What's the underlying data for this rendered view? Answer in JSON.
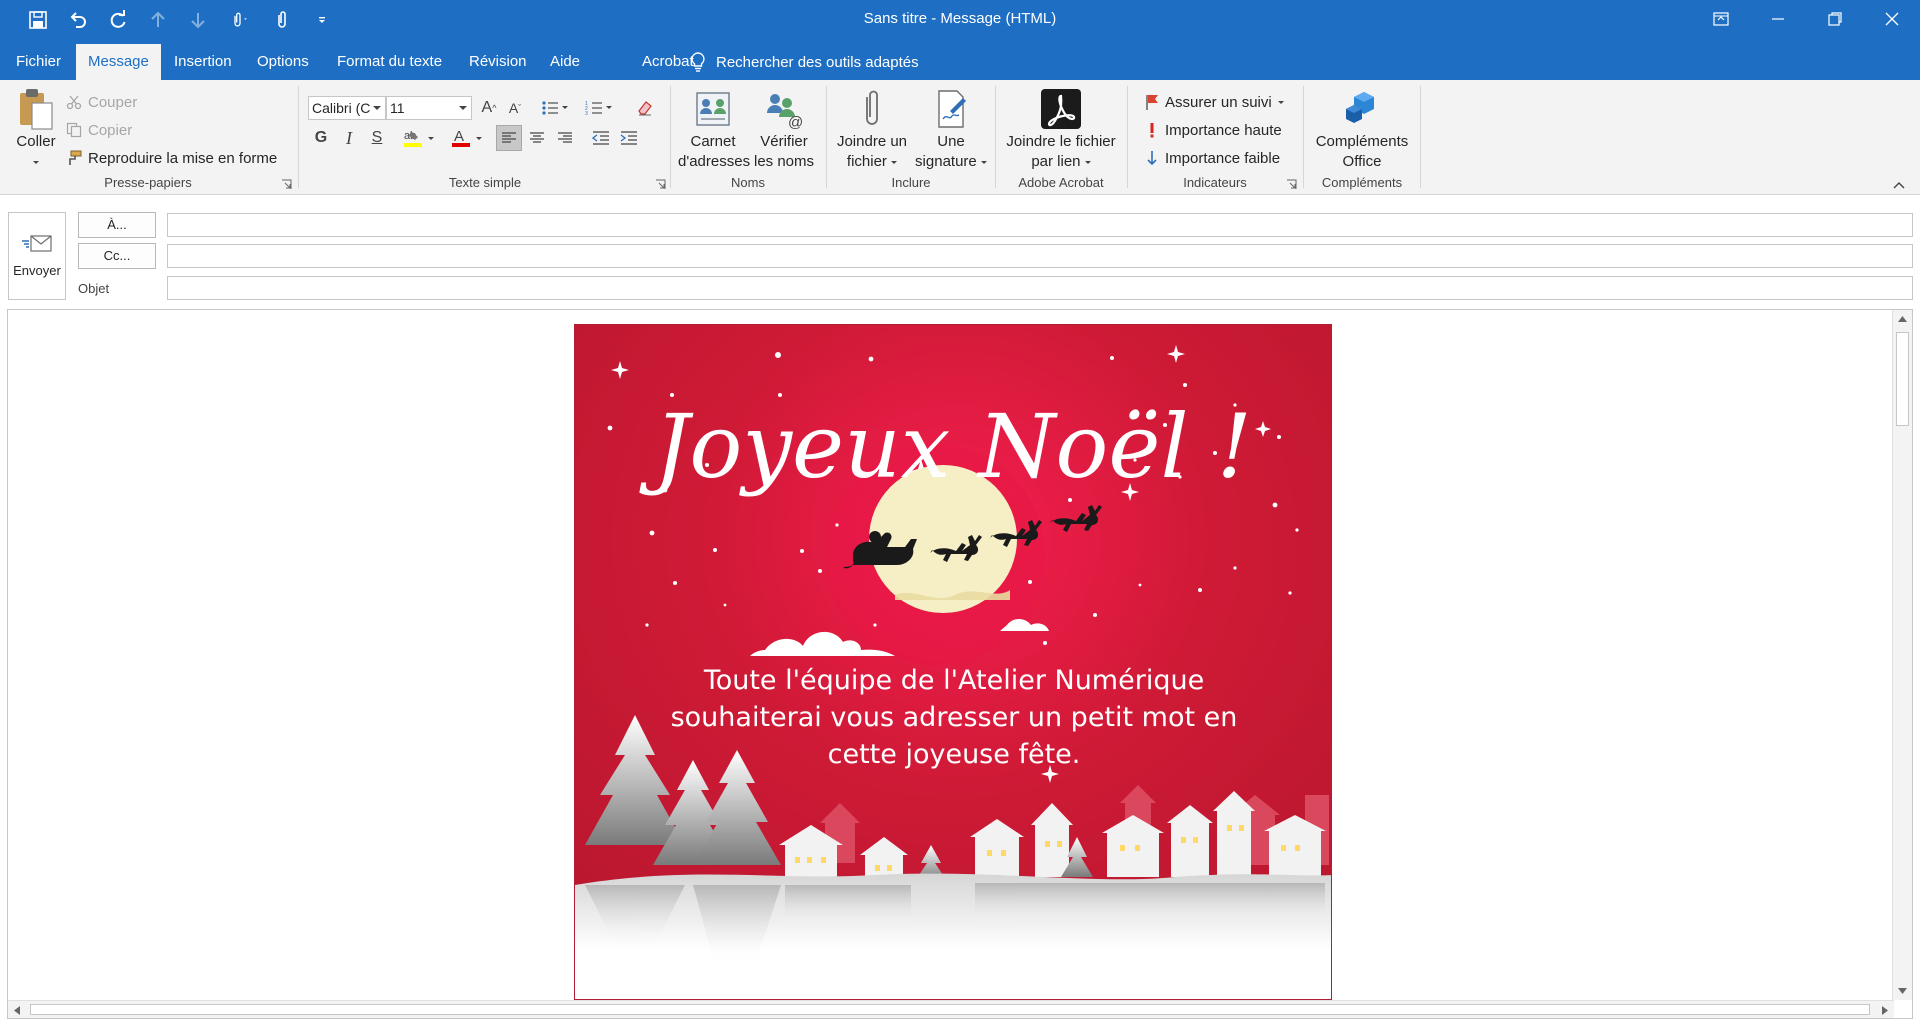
{
  "window": {
    "title": "Sans titre  -  Message (HTML)"
  },
  "tabs": [
    {
      "label": "Fichier"
    },
    {
      "label": "Message"
    },
    {
      "label": "Insertion"
    },
    {
      "label": "Options"
    },
    {
      "label": "Format du texte"
    },
    {
      "label": "Révision"
    },
    {
      "label": "Aide"
    },
    {
      "label": "Acrobat"
    }
  ],
  "tell_me": "Rechercher des outils adaptés",
  "ribbon": {
    "clipboard": {
      "label": "Presse-papiers",
      "paste": "Coller",
      "cut": "Couper",
      "copy": "Copier",
      "format_painter": "Reproduire la mise en forme"
    },
    "basic_text": {
      "label": "Texte simple",
      "font": "Calibri (C",
      "size": "11"
    },
    "names": {
      "label": "Noms",
      "address_book": [
        "Carnet",
        "d'adresses"
      ],
      "check_names": [
        "Vérifier",
        "les noms"
      ]
    },
    "include": {
      "label": "Inclure",
      "attach_file": [
        "Joindre un",
        "fichier"
      ],
      "signature": [
        "Une",
        "signature"
      ]
    },
    "acrobat": {
      "label": "Adobe Acrobat",
      "attach_link": [
        "Joindre le fichier",
        "par lien"
      ]
    },
    "tags": {
      "label": "Indicateurs",
      "follow_up": "Assurer un suivi",
      "high": "Importance haute",
      "low": "Importance faible"
    },
    "addins": {
      "label": "Compléments",
      "office": [
        "Compléments",
        "Office"
      ]
    }
  },
  "header": {
    "send": "Envoyer",
    "to": "À...",
    "cc": "Cc...",
    "subject": "Objet",
    "to_value": "",
    "cc_value": "",
    "subject_value": ""
  },
  "card": {
    "title": "Joyeux Noël !",
    "message": [
      "Toute l'équipe de l'Atelier Numérique",
      "souhaiterai vous adresser un petit mot en",
      "cette joyeuse fête."
    ]
  },
  "colors": {
    "accent": "#1e6fc4",
    "card_red": "#c01a34",
    "moon": "#f6efc6"
  }
}
